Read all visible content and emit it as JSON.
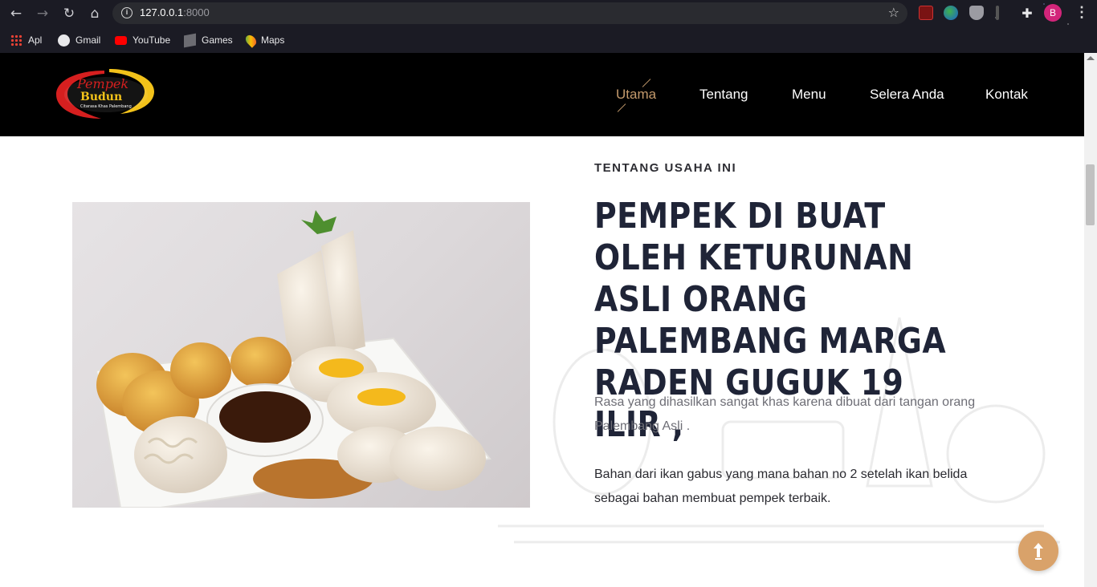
{
  "browser": {
    "url_host": "127.0.0.1",
    "url_port": ":8000",
    "avatar_letter": "B",
    "bookmarks": [
      {
        "label": "Apl",
        "icon": "apps-grid-icon"
      },
      {
        "label": "Gmail",
        "icon": "globe-icon"
      },
      {
        "label": "YouTube",
        "icon": "youtube-icon"
      },
      {
        "label": "Games",
        "icon": "games-icon"
      },
      {
        "label": "Maps",
        "icon": "maps-pin-icon"
      }
    ]
  },
  "site": {
    "logo": {
      "line1": "Pempek",
      "line2": "Budun",
      "tagline": "Citarasa Khas Palembang"
    },
    "nav": [
      {
        "label": "Utama",
        "active": true
      },
      {
        "label": "Tentang",
        "active": false
      },
      {
        "label": "Menu",
        "active": false
      },
      {
        "label": "Selera Anda",
        "active": false
      },
      {
        "label": "Kontak",
        "active": false
      }
    ],
    "accent_color": "#c49a6c",
    "header_bg": "#000000"
  },
  "about": {
    "eyebrow": "TENTANG USAHA INI",
    "headline": "PEMPEK DI BUAT OLEH KETURUNAN ASLI ORANG PALEMBANG MARGA RADEN GUGUK 19 ILIR ,",
    "paragraph1": "Rasa yang dihasilkan sangat khas karena dibuat dari tangan orang Palembang Asli .",
    "paragraph2": "Bahan dari ikan gabus yang mana bahan no 2 setelah ikan belida sebagai bahan membuat pempek terbaik.",
    "image_subject": "plate of pempek with cuko sauce"
  },
  "back_to_top": {
    "icon": "arrow-up-icon",
    "color": "#d9a26a"
  }
}
